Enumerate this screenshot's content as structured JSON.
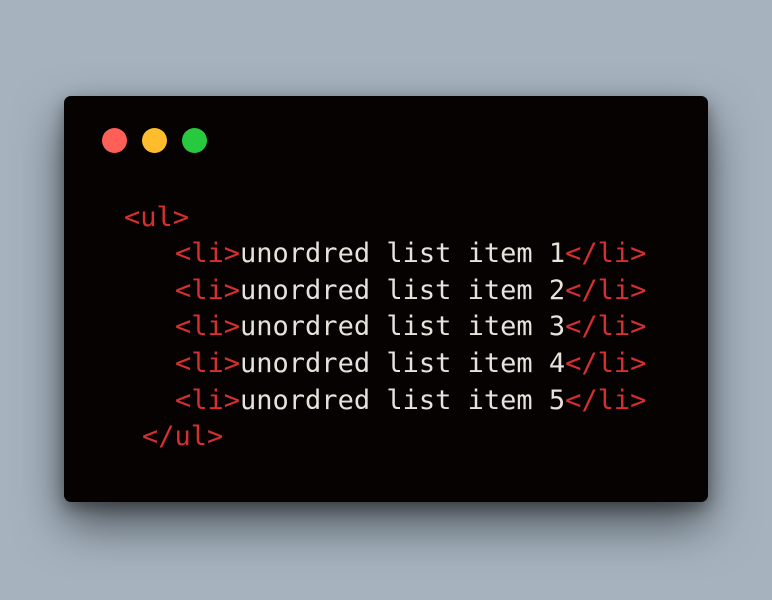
{
  "window": {
    "controls": [
      {
        "name": "close",
        "color": "#ff5f56"
      },
      {
        "name": "minimize",
        "color": "#ffbd2e"
      },
      {
        "name": "maximize",
        "color": "#27c93f"
      }
    ]
  },
  "code": {
    "open_ul": "<ul>",
    "close_ul": "</ul>",
    "li_open": "<li>",
    "li_close": "</li>",
    "items": [
      "unordred list item 1",
      "unordred list item 2",
      "unordred list item 3",
      "unordred list item 4",
      "unordred list item 5"
    ]
  },
  "colors": {
    "background": "#a6b3bf",
    "window": "#070202",
    "tag": "#d62f2f",
    "text": "#e8e2dd"
  }
}
